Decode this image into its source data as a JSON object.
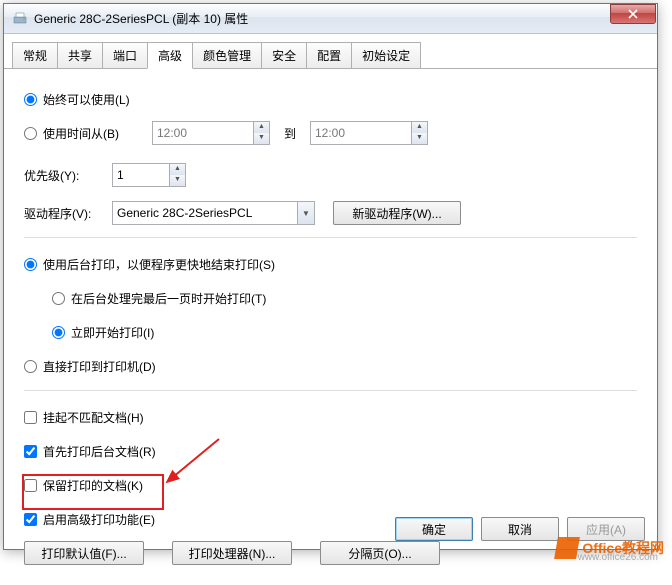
{
  "title": "Generic 28C-2SeriesPCL (副本 10) 属性",
  "tabs": [
    "常规",
    "共享",
    "端口",
    "高级",
    "颜色管理",
    "安全",
    "配置",
    "初始设定"
  ],
  "active_tab_index": 3,
  "always_available": "始终可以使用(L)",
  "use_time_from": "使用时间从(B)",
  "time_from": "12:00",
  "to_label": "到",
  "time_to": "12:00",
  "priority_label": "优先级(Y):",
  "priority_value": "1",
  "driver_label": "驱动程序(V):",
  "driver_value": "Generic 28C-2SeriesPCL",
  "new_driver_btn": "新驱动程序(W)...",
  "spool_label": "使用后台打印，以便程序更快地结束打印(S)",
  "spool_after": "在后台处理完最后一页时开始打印(T)",
  "spool_immediate": "立即开始打印(I)",
  "direct_print": "直接打印到打印机(D)",
  "hold_mismatch": "挂起不匹配文档(H)",
  "print_spooled_first": "首先打印后台文档(R)",
  "keep_docs": "保留打印的文档(K)",
  "enable_advanced": "启用高级打印功能(E)",
  "btn_defaults": "打印默认值(F)...",
  "btn_processor": "打印处理器(N)...",
  "btn_separator": "分隔页(O)...",
  "ok": "确定",
  "cancel": "取消",
  "apply": "应用(A)",
  "watermark_brand": "Office教程网",
  "watermark_url": "www.office26.com"
}
